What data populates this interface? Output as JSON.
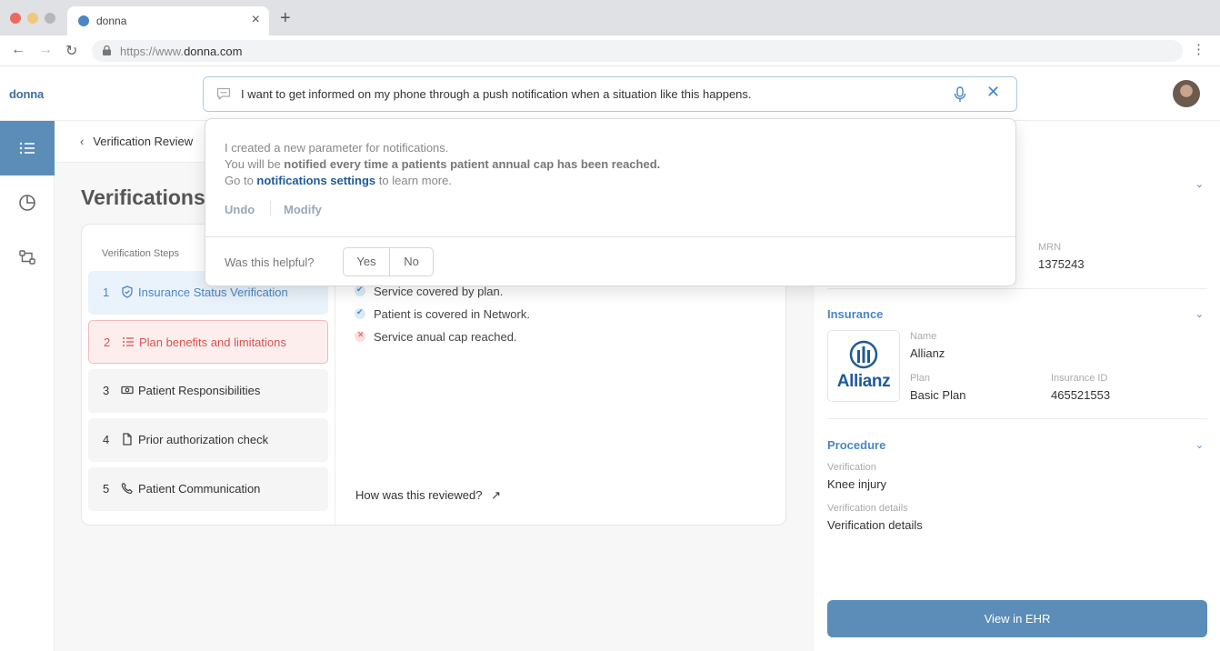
{
  "browser": {
    "tab_title": "donna",
    "url_prefix": "https://www.",
    "url_domain": "donna.com"
  },
  "app": {
    "logo": "donna",
    "command": {
      "text": "I want to get informed on my phone through a push notification when a situation like this happens."
    }
  },
  "breadcrumb": {
    "label": "Verification Review"
  },
  "page": {
    "title": "Verifications"
  },
  "steps": {
    "heading": "Verification Steps",
    "items": [
      {
        "num": "1",
        "label": "Insurance Status Verification",
        "icon": "shield-icon"
      },
      {
        "num": "2",
        "label": "Plan benefits and limitations",
        "icon": "list-icon"
      },
      {
        "num": "3",
        "label": "Patient Responsibilities",
        "icon": "cash-icon"
      },
      {
        "num": "4",
        "label": "Prior authorization check",
        "icon": "document-icon"
      },
      {
        "num": "5",
        "label": "Patient Communication",
        "icon": "phone-icon"
      }
    ]
  },
  "checks": [
    {
      "label": "Service covered by plan.",
      "status": "ok"
    },
    {
      "label": "Patient is covered in Network.",
      "status": "ok"
    },
    {
      "label": "Service anual cap reached.",
      "status": "fail"
    }
  ],
  "review_link": "How was this reviewed?",
  "popup": {
    "line1": "I created a new parameter for notifications.",
    "line2_prefix": "You will be ",
    "line2_bold": "notified every time a patients patient annual cap has been reached.",
    "line3_prefix": "Go to ",
    "line3_link": "notifications settings",
    "line3_suffix": " to learn more.",
    "undo": "Undo",
    "modify": "Modify",
    "helpful": "Was this helpful?",
    "yes": "Yes",
    "no": "No"
  },
  "panel": {
    "mrn_label": "MRN",
    "mrn_value": "1375243",
    "insurance": {
      "title": "Insurance",
      "logo_text": "Allianz",
      "name_label": "Name",
      "name_value": "Allianz",
      "plan_label": "Plan",
      "plan_value": "Basic Plan",
      "id_label": "Insurance ID",
      "id_value": "465521553"
    },
    "procedure": {
      "title": "Procedure",
      "verification_label": "Verification",
      "verification_value": "Knee injury",
      "details_label": "Verification details",
      "details_value": "Verification details"
    },
    "ehr_button": "View in EHR"
  },
  "colors": {
    "accent": "#5b8db8",
    "link": "#4a86c5",
    "danger": "#d9534f"
  }
}
